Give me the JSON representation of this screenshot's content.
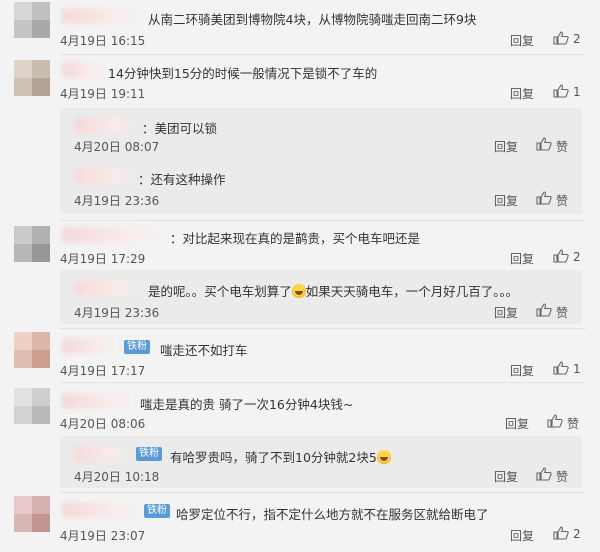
{
  "comments": [
    {
      "text": "从南二环骑美团到博物院4块，从博物院骑嗤走回南二环9块",
      "time": "4月19日 16:15",
      "reply_label": "回复",
      "likes": "2"
    },
    {
      "text": "14分钟快到15分的时候一般情况下是锁不了车的",
      "time": "4月19日 19:11",
      "reply_label": "回复",
      "likes": "1",
      "replies": [
        {
          "text": "：美团可以锁",
          "time": "4月20日 08:07",
          "reply_label": "回复",
          "like_label": "赞"
        },
        {
          "text": "：还有这种操作",
          "time": "4月19日 23:36",
          "reply_label": "回复",
          "like_label": "赞"
        }
      ]
    },
    {
      "text": "：对比起来现在真的是鹋贵，买个电车吧还是",
      "time": "4月19日 17:29",
      "reply_label": "回复",
      "likes": "2",
      "replies": [
        {
          "text_a": "是的呢。。买个电车划算了",
          "text_b": "如果天天骑电车，一个月好几百了。。。",
          "time": "4月19日 23:36",
          "reply_label": "回复",
          "like_label": "赞"
        }
      ]
    },
    {
      "badge": "铁粉",
      "text": "嗤走还不如打车",
      "time": "4月19日 17:17",
      "reply_label": "回复",
      "likes": "1"
    },
    {
      "text": "嗤走是真的贵 骑了一次16分钟4块钱~",
      "time": "4月20日 08:06",
      "reply_label": "回复",
      "like_label": "赞",
      "replies": [
        {
          "badge": "铁粉",
          "text": "有哈罗贵吗，骑了不到10分钟就2块5",
          "time": "4月20日 10:18",
          "reply_label": "回复",
          "like_label": "赞"
        }
      ]
    },
    {
      "badge": "铁粉",
      "text": "哈罗定位不行，指不定什么地方就不在服务区就给断电了",
      "time": "4月19日 23:07",
      "reply_label": "回复",
      "likes": "2"
    }
  ],
  "colors": {
    "background": "#f3f3f3",
    "sub_background": "#ebebeb",
    "badge": "#5b9bd5"
  },
  "icons": {
    "like": "thumbs-up-icon",
    "emoji": "laughing-emoji-icon"
  }
}
